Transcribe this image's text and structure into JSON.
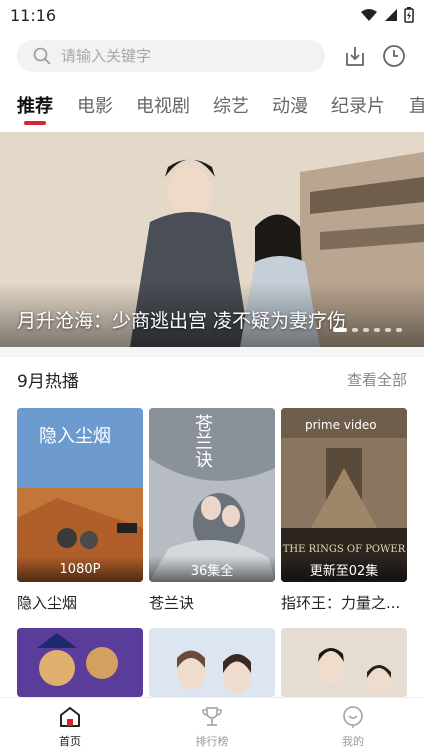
{
  "status": {
    "time": "11:16"
  },
  "search": {
    "placeholder": "请输入关键字"
  },
  "tabs": [
    {
      "label": "推荐"
    },
    {
      "label": "电影"
    },
    {
      "label": "电视剧"
    },
    {
      "label": "综艺"
    },
    {
      "label": "动漫"
    },
    {
      "label": "纪录片"
    },
    {
      "label": "直"
    }
  ],
  "banner": {
    "title": "月升沧海：少商逃出宫 凌不疑为妻疗伤",
    "dots_total": 6,
    "active_dot": 0
  },
  "section": {
    "title": "9月热播",
    "more": "查看全部"
  },
  "posters": [
    {
      "name": "隐入尘烟",
      "badge": "1080P",
      "poster_text": "隐入尘烟",
      "color": "#4b7fb8"
    },
    {
      "name": "苍兰诀",
      "badge": "36集全",
      "poster_text": "苍兰诀",
      "color": "#9aa0a6"
    },
    {
      "name": "指环王：力量之...",
      "badge": "更新至02集",
      "poster_text": "prime video",
      "poster_subtext": "THE RINGS OF POWER",
      "color": "#5c4d3c"
    },
    {
      "name": "",
      "badge": "",
      "color": "#3d4fa0"
    },
    {
      "name": "",
      "badge": "",
      "color": "#c9d6e6"
    },
    {
      "name": "",
      "badge": "",
      "color": "#d9cfc3"
    }
  ],
  "bottom_nav": [
    {
      "label": "首页",
      "active": true
    },
    {
      "label": "排行榜",
      "active": false
    },
    {
      "label": "我的",
      "active": false
    }
  ],
  "colors": {
    "accent": "#d8232a"
  }
}
